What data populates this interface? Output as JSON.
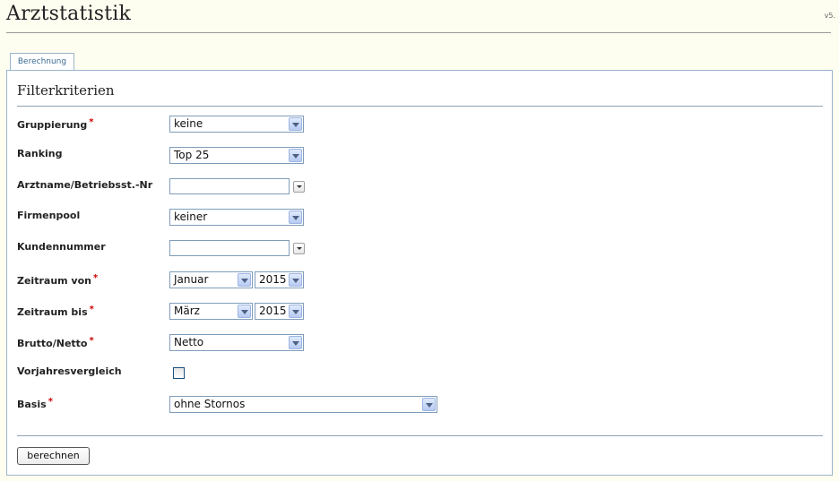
{
  "header": {
    "title": "Arztstatistik",
    "version": "v5."
  },
  "tabs": [
    {
      "label": "Berechnung"
    }
  ],
  "panel": {
    "title": "Filterkriterien"
  },
  "form": {
    "gruppierung": {
      "label": "Gruppierung",
      "required": "*",
      "value": "keine"
    },
    "ranking": {
      "label": "Ranking",
      "value": "Top 25"
    },
    "arztname": {
      "label": "Arztname/Betriebsst.-Nr",
      "value": ""
    },
    "firmenpool": {
      "label": "Firmenpool",
      "value": "keiner"
    },
    "kundennummer": {
      "label": "Kundennummer",
      "value": ""
    },
    "zeitraum_von": {
      "label": "Zeitraum von",
      "required": "*",
      "month": "Januar",
      "year": "2015"
    },
    "zeitraum_bis": {
      "label": "Zeitraum bis",
      "required": "*",
      "month": "März",
      "year": "2015"
    },
    "brutto_netto": {
      "label": "Brutto/Netto",
      "required": "*",
      "value": "Netto"
    },
    "vorjahresvergleich": {
      "label": "Vorjahresvergleich",
      "checked": false
    },
    "basis": {
      "label": "Basis",
      "required": "*",
      "value": "ohne Stornos"
    }
  },
  "actions": {
    "calculate_label": "berechnen"
  }
}
